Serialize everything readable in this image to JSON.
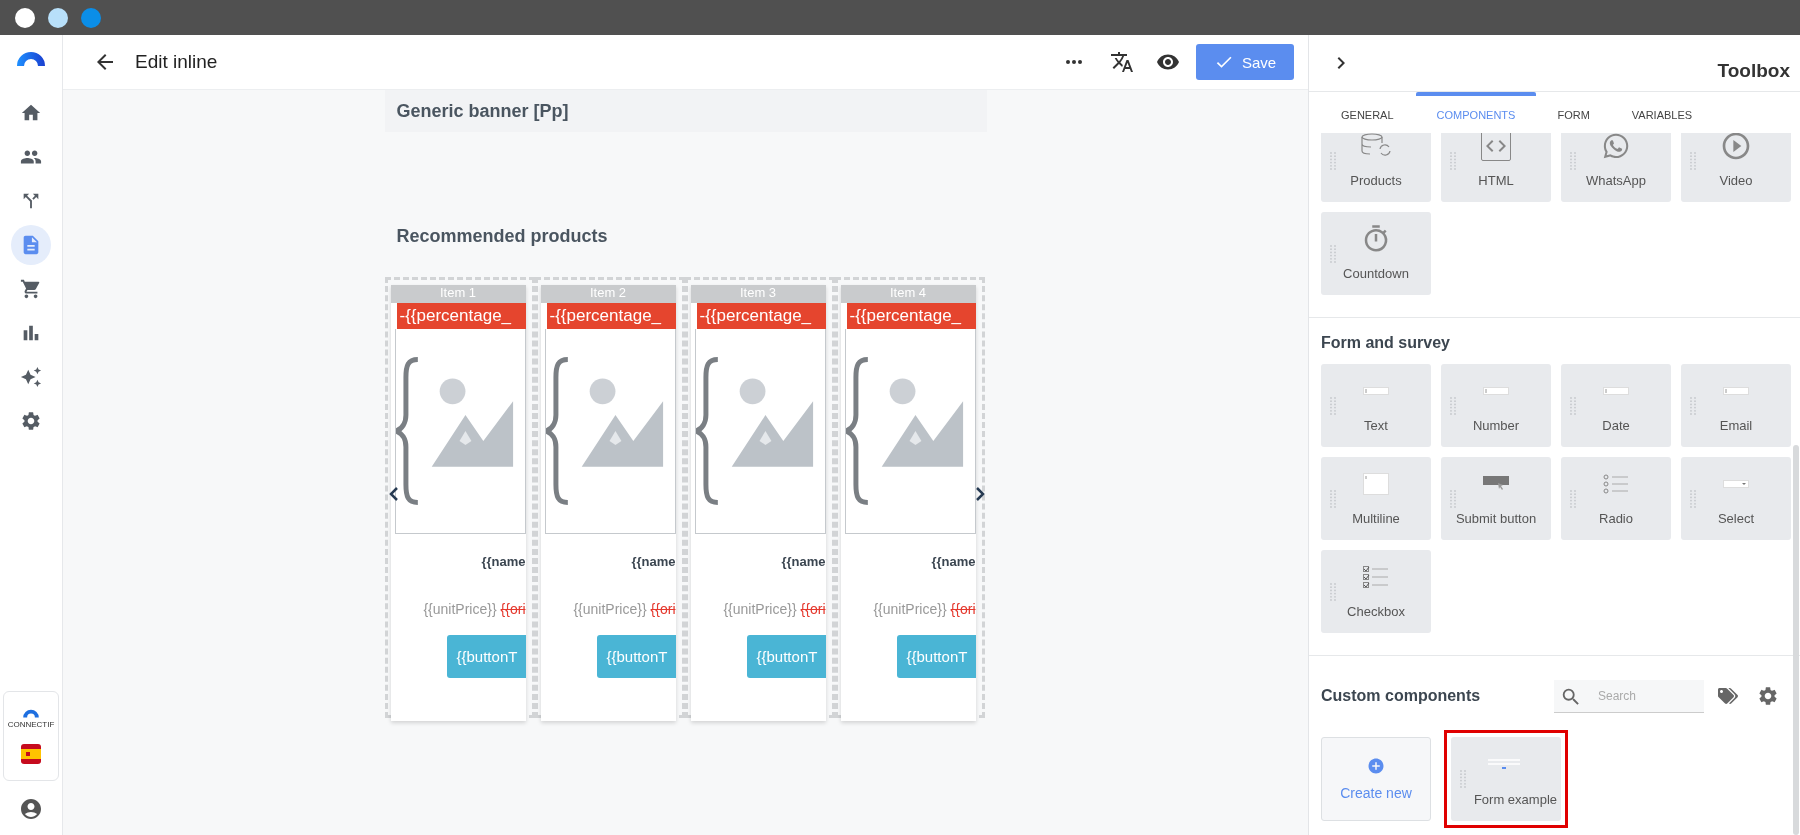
{
  "sidebar": {
    "items": [
      {
        "selected": false
      },
      {
        "selected": false
      },
      {
        "selected": false
      },
      {
        "selected": true
      },
      {
        "selected": false
      },
      {
        "selected": false
      },
      {
        "selected": false
      },
      {
        "selected": false
      }
    ],
    "brand_caption": "CONNECTIF"
  },
  "header": {
    "title": "Edit inline",
    "save_label": "Save"
  },
  "canvas": {
    "banner_title": "Generic banner [Pp]",
    "section_title": "Recommended products",
    "products": [
      {
        "item_label": "Item 1",
        "badge": "-{{percentage_",
        "name": "{{name",
        "price": "{{unitPrice}}",
        "original_price": "{{ori",
        "button": "{{buttonT"
      },
      {
        "item_label": "Item 2",
        "badge": "-{{percentage_",
        "name": "{{name",
        "price": "{{unitPrice}}",
        "original_price": "{{ori",
        "button": "{{buttonT"
      },
      {
        "item_label": "Item 3",
        "badge": "-{{percentage_",
        "name": "{{name",
        "price": "{{unitPrice}}",
        "original_price": "{{ori",
        "button": "{{buttonT"
      },
      {
        "item_label": "Item 4",
        "badge": "-{{percentage_",
        "name": "{{name",
        "price": "{{unitPrice}}",
        "original_price": "{{ori",
        "button": "{{buttonT"
      }
    ]
  },
  "toolbox": {
    "title": "Toolbox",
    "tabs": [
      {
        "label": "GENERAL",
        "selected": false
      },
      {
        "label": "COMPONENTS",
        "selected": true
      },
      {
        "label": "FORM",
        "selected": false
      },
      {
        "label": "VARIABLES",
        "selected": false
      }
    ],
    "components": [
      {
        "label": "Products"
      },
      {
        "label": "HTML"
      },
      {
        "label": "WhatsApp"
      },
      {
        "label": "Video"
      },
      {
        "label": "Countdown"
      }
    ],
    "form_section": {
      "title": "Form and survey",
      "items": [
        {
          "label": "Text"
        },
        {
          "label": "Number"
        },
        {
          "label": "Date"
        },
        {
          "label": "Email"
        },
        {
          "label": "Multiline"
        },
        {
          "label": "Submit button"
        },
        {
          "label": "Radio"
        },
        {
          "label": "Select"
        },
        {
          "label": "Checkbox"
        }
      ]
    },
    "custom_section": {
      "title": "Custom components",
      "search_placeholder": "Search",
      "create_label": "Create new",
      "items": [
        {
          "label": "Form example",
          "highlighted": true
        }
      ]
    }
  }
}
